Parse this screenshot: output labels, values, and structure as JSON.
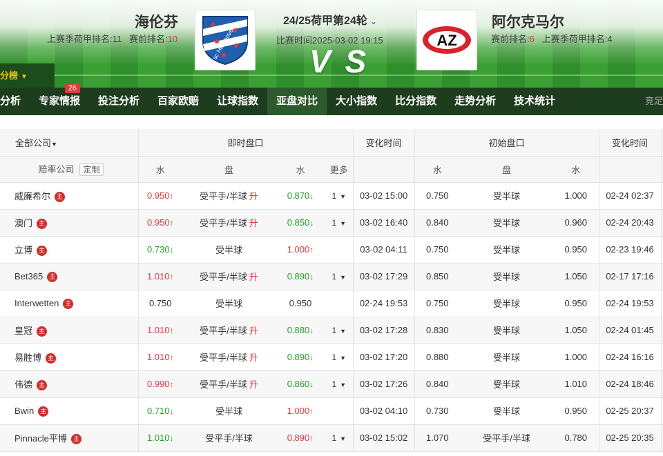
{
  "header": {
    "home_team": "海伦芬",
    "home_last_rank_label": "上赛季荷甲排名:11",
    "home_current_rank_label": "赛前排名:",
    "home_current_rank": "10",
    "away_team": "阿尔克马尔",
    "away_current_rank_label": "赛前排名:",
    "away_current_rank": "6",
    "away_last_rank_label": "上赛季荷甲排名:4",
    "league": "24/25荷甲第24轮",
    "match_time": "比赛时间2025-03-02 19:15",
    "vs": "V S",
    "score_tab": "积分榜",
    "home_logo_text": "sc Heerenveen",
    "away_logo_text": "AZ"
  },
  "nav": {
    "items": [
      "分析",
      "专家情报",
      "投注分析",
      "百家欧赔",
      "让球指数",
      "亚盘对比",
      "大小指数",
      "比分指数",
      "走势分析",
      "技术统计"
    ],
    "active_index": 5,
    "badge_index": 1,
    "badge": "26",
    "right_text": "竞足"
  },
  "table": {
    "header_top": {
      "company_filter": "全部公司",
      "live": "即时盘口",
      "change_time": "变化时间",
      "initial": "初始盘口",
      "change_time2": "变化时间"
    },
    "header_sub": {
      "company": "赔率公司",
      "custom": "定制",
      "water1": "水",
      "line": "盘",
      "water2": "水",
      "more": "更多",
      "init_water1": "水",
      "init_line": "盘",
      "init_water2": "水"
    },
    "zhu_label": "主",
    "rows": [
      {
        "company": "威廉希尔",
        "w1": "0.950",
        "w1_dir": "up",
        "line": "受平手/半球",
        "line_up": "升",
        "w2": "0.870",
        "w2_dir": "down",
        "more": "1",
        "time": "03-02 15:00",
        "iw1": "0.750",
        "iline": "受半球",
        "iw2": "1.000",
        "itime": "02-24 02:37"
      },
      {
        "company": "澳门",
        "w1": "0.950",
        "w1_dir": "up",
        "line": "受平手/半球",
        "line_up": "升",
        "w2": "0.850",
        "w2_dir": "down",
        "more": "1",
        "time": "03-02 16:40",
        "iw1": "0.840",
        "iline": "受半球",
        "iw2": "0.960",
        "itime": "02-24 20:43"
      },
      {
        "company": "立博",
        "w1": "0.730",
        "w1_dir": "down",
        "line": "受半球",
        "line_up": "",
        "w2": "1.000",
        "w2_dir": "up",
        "more": "",
        "time": "03-02 04:11",
        "iw1": "0.750",
        "iline": "受半球",
        "iw2": "0.950",
        "itime": "02-23 19:46"
      },
      {
        "company": "Bet365",
        "w1": "1.010",
        "w1_dir": "up",
        "line": "受平手/半球",
        "line_up": "升",
        "w2": "0.890",
        "w2_dir": "down",
        "more": "1",
        "time": "03-02 17:29",
        "iw1": "0.850",
        "iline": "受半球",
        "iw2": "1.050",
        "itime": "02-17 17:16"
      },
      {
        "company": "Interwetten",
        "w1": "0.750",
        "w1_dir": "",
        "line": "受半球",
        "line_up": "",
        "w2": "0.950",
        "w2_dir": "",
        "more": "",
        "time": "02-24 19:53",
        "iw1": "0.750",
        "iline": "受半球",
        "iw2": "0.950",
        "itime": "02-24 19:53"
      },
      {
        "company": "皇冠",
        "w1": "1.010",
        "w1_dir": "up",
        "line": "受平手/半球",
        "line_up": "升",
        "w2": "0.880",
        "w2_dir": "down",
        "more": "1",
        "time": "03-02 17:28",
        "iw1": "0.830",
        "iline": "受半球",
        "iw2": "1.050",
        "itime": "02-24 01:45"
      },
      {
        "company": "易胜博",
        "w1": "1.010",
        "w1_dir": "up",
        "line": "受平手/半球",
        "line_up": "升",
        "w2": "0.890",
        "w2_dir": "down",
        "more": "1",
        "time": "03-02 17:20",
        "iw1": "0.880",
        "iline": "受半球",
        "iw2": "1.000",
        "itime": "02-24 16:16"
      },
      {
        "company": "伟德",
        "w1": "0.990",
        "w1_dir": "up",
        "line": "受平手/半球",
        "line_up": "升",
        "w2": "0.860",
        "w2_dir": "down",
        "more": "1",
        "time": "03-02 17:26",
        "iw1": "0.840",
        "iline": "受半球",
        "iw2": "1.010",
        "itime": "02-24 18:46"
      },
      {
        "company": "Bwin",
        "w1": "0.710",
        "w1_dir": "down",
        "line": "受半球",
        "line_up": "",
        "w2": "1.000",
        "w2_dir": "up",
        "more": "",
        "time": "03-02 04:10",
        "iw1": "0.730",
        "iline": "受半球",
        "iw2": "0.950",
        "itime": "02-25 20:37"
      },
      {
        "company": "Pinnacle平博",
        "w1": "1.010",
        "w1_dir": "down",
        "line": "受平手/半球",
        "line_up": "",
        "w2": "0.890",
        "w2_dir": "up",
        "more": "1",
        "time": "03-02 15:02",
        "iw1": "1.070",
        "iline": "受平手/半球",
        "iw2": "0.780",
        "itime": "02-25 20:35"
      }
    ]
  },
  "colors": {
    "up": "#e4393c",
    "down": "#22a02a",
    "nav_bg": "#1e3d1e",
    "badge": "#e4393c"
  }
}
